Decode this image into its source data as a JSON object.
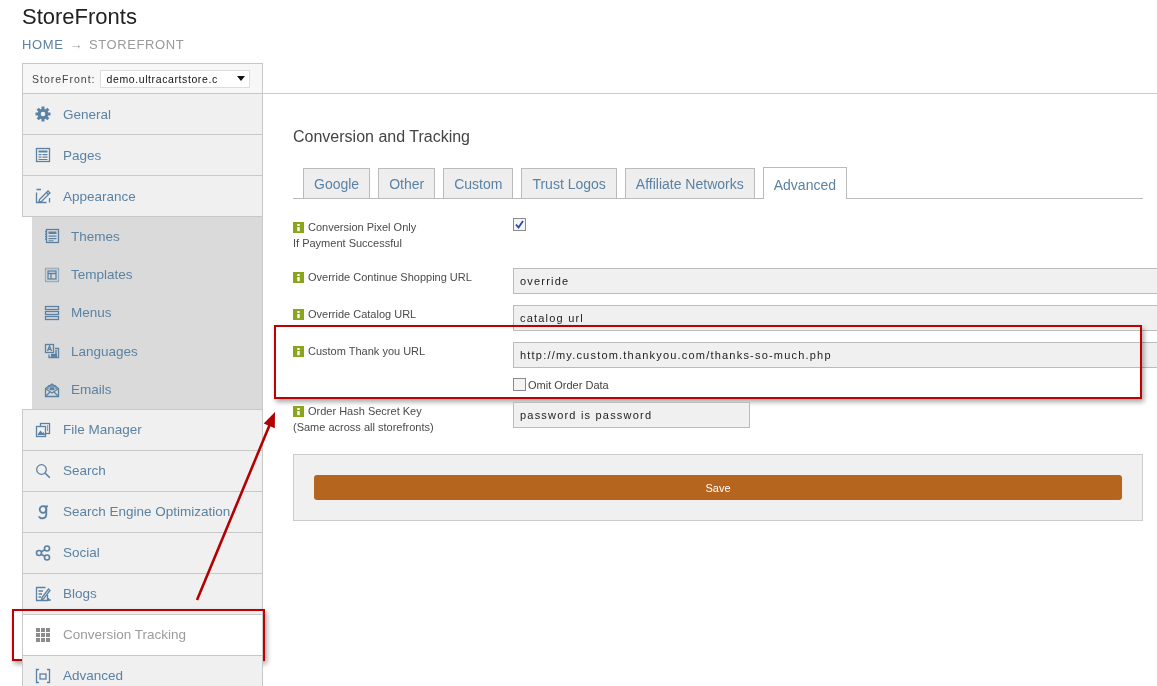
{
  "page": {
    "title": "StoreFronts",
    "breadcrumb": [
      {
        "label": "HOME",
        "link": true
      },
      {
        "label": "STOREFRONT",
        "link": false
      }
    ],
    "separator": "→"
  },
  "sidebar": {
    "selector": {
      "label": "StoreFront:",
      "value": "demo.ultracartstore.c"
    },
    "items": [
      {
        "label": "General",
        "selected": false,
        "highlighted": false
      },
      {
        "label": "Pages",
        "selected": false,
        "highlighted": false
      },
      {
        "label": "Appearance",
        "selected": false,
        "highlighted": false,
        "children": [
          {
            "label": "Themes",
            "selected": false
          },
          {
            "label": "Templates",
            "selected": false
          },
          {
            "label": "Menus",
            "selected": false
          },
          {
            "label": "Languages",
            "selected": false
          },
          {
            "label": "Emails",
            "selected": false
          }
        ]
      },
      {
        "label": "File Manager",
        "selected": false,
        "highlighted": false
      },
      {
        "label": "Search",
        "selected": false,
        "highlighted": false
      },
      {
        "label": "Search Engine Optimization",
        "selected": false,
        "highlighted": false
      },
      {
        "label": "Social",
        "selected": false,
        "highlighted": false
      },
      {
        "label": "Blogs",
        "selected": false,
        "highlighted": false
      },
      {
        "label": "Conversion Tracking",
        "selected": true,
        "highlighted": true
      },
      {
        "label": "Advanced",
        "selected": false,
        "highlighted": false
      }
    ]
  },
  "section": {
    "title": "Conversion and Tracking",
    "tabs": [
      {
        "label": "Google",
        "selected": false
      },
      {
        "label": "Other",
        "selected": false
      },
      {
        "label": "Custom",
        "selected": false
      },
      {
        "label": "Trust Logos",
        "selected": false
      },
      {
        "label": "Affiliate Networks",
        "selected": false
      },
      {
        "label": "Advanced",
        "selected": true
      }
    ],
    "fields": [
      {
        "kind": "checkbox",
        "label": [
          "Conversion Pixel Only",
          "If Payment Successful"
        ],
        "checked": true,
        "highlighted": false
      },
      {
        "kind": "text",
        "label": [
          "Override Continue Shopping URL"
        ],
        "value": "override",
        "highlighted": false
      },
      {
        "kind": "text",
        "label": [
          "Override Catalog URL"
        ],
        "value": "catalog url",
        "highlighted": false
      },
      {
        "kind": "text",
        "label": [
          "Custom Thank you URL"
        ],
        "value": "http://my.custom.thankyou.com/thanks-so-much.php",
        "option": {
          "label": "Omit Order Data",
          "checked": false
        },
        "highlighted": true
      },
      {
        "kind": "secret",
        "label": [
          "Order Hash Secret Key",
          "(Same across all storefronts)"
        ],
        "value": "password is password",
        "highlighted": false
      }
    ],
    "save_button": "Save"
  },
  "callout_arrow": true
}
